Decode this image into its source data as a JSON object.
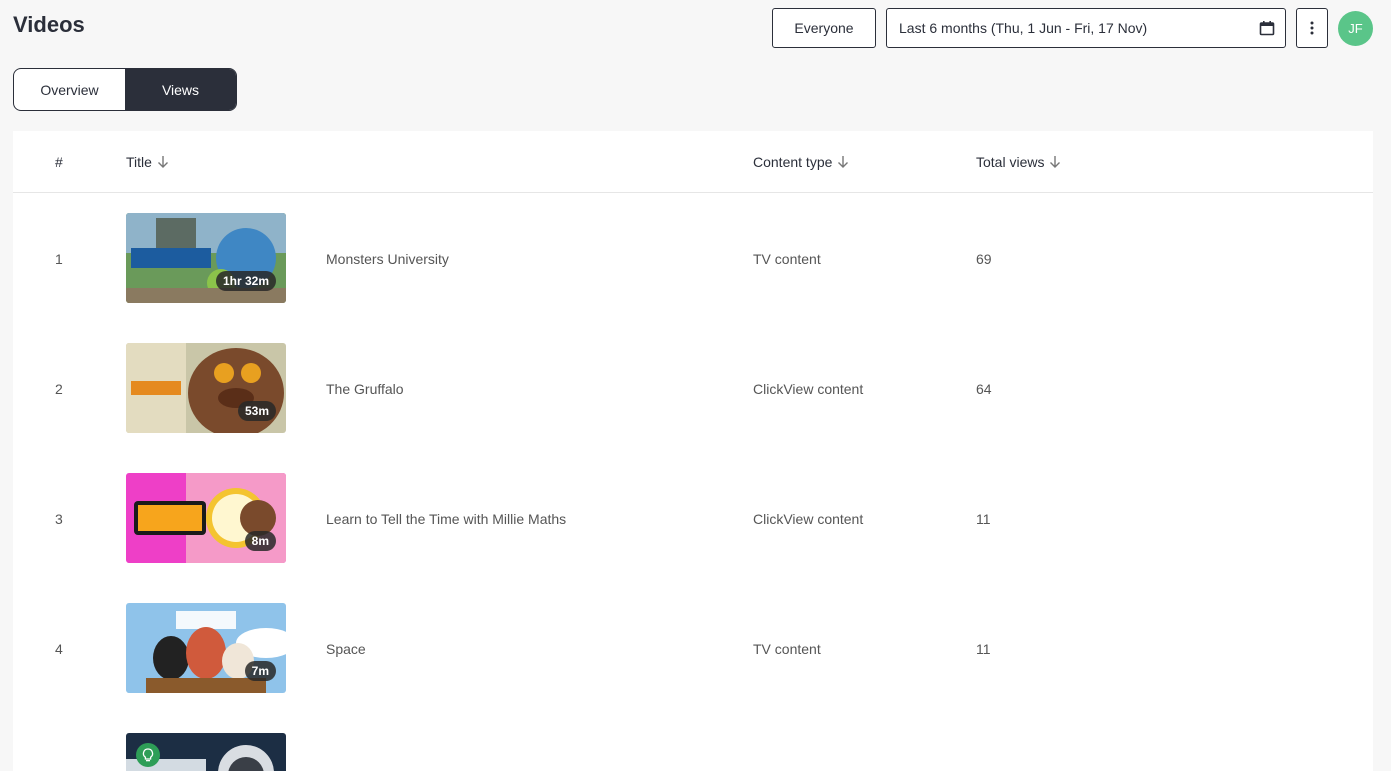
{
  "page": {
    "title": "Videos"
  },
  "filters": {
    "audience_label": "Everyone",
    "date_range": "Last 6 months (Thu, 1 Jun - Fri, 17 Nov)"
  },
  "user": {
    "initials": "JF",
    "avatar_color": "#5ac589"
  },
  "tabs": [
    {
      "label": "Overview",
      "active": false
    },
    {
      "label": "Views",
      "active": true
    }
  ],
  "table": {
    "headers": {
      "rank": "#",
      "title": "Title",
      "content_type": "Content type",
      "total_views": "Total views"
    },
    "rows": [
      {
        "rank": "1",
        "title": "Monsters University",
        "duration": "1hr 32m",
        "content_type": "TV content",
        "views": "69"
      },
      {
        "rank": "2",
        "title": "The Gruffalo",
        "duration": "53m",
        "content_type": "ClickView content",
        "views": "64"
      },
      {
        "rank": "3",
        "title": "Learn to Tell the Time with Millie Maths",
        "duration": "8m",
        "content_type": "ClickView content",
        "views": "11"
      },
      {
        "rank": "4",
        "title": "Space",
        "duration": "7m",
        "content_type": "TV content",
        "views": "11"
      }
    ]
  },
  "colors": {
    "dark": "#2b2f3a",
    "accent_green": "#5ac589"
  }
}
